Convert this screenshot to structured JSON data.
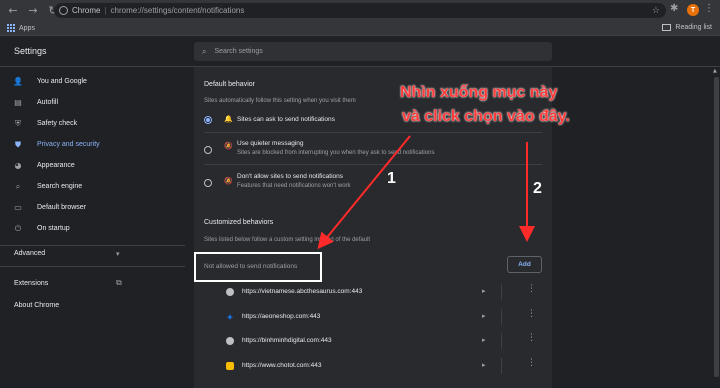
{
  "browser": {
    "site_label": "Chrome",
    "url": "chrome://settings/content/notifications",
    "avatar_letter": "T",
    "bookmarks_apps": "Apps",
    "reading_list": "Reading list"
  },
  "header": {
    "title": "Settings",
    "search_placeholder": "Search settings"
  },
  "sidebar": {
    "items": [
      {
        "label": "You and Google",
        "icon": "person-icon"
      },
      {
        "label": "Autofill",
        "icon": "clipboard-icon"
      },
      {
        "label": "Safety check",
        "icon": "shield-check-icon"
      },
      {
        "label": "Privacy and security",
        "icon": "shield-icon"
      },
      {
        "label": "Appearance",
        "icon": "palette-icon"
      },
      {
        "label": "Search engine",
        "icon": "search-icon"
      },
      {
        "label": "Default browser",
        "icon": "browser-icon"
      },
      {
        "label": "On startup",
        "icon": "power-icon"
      }
    ],
    "advanced": "Advanced",
    "extensions": "Extensions",
    "about": "About Chrome"
  },
  "content": {
    "default_behavior": {
      "title": "Default behavior",
      "subtitle": "Sites automatically follow this setting when you visit them",
      "options": [
        {
          "label": "Sites can ask to send notifications",
          "desc": "",
          "selected": true
        },
        {
          "label": "Use quieter messaging",
          "desc": "Sites are blocked from interrupting you when they ask to send notifications",
          "selected": false
        },
        {
          "label": "Don't allow sites to send notifications",
          "desc": "Features that need notifications won't work",
          "selected": false
        }
      ]
    },
    "customized": {
      "title": "Customized behaviors",
      "subtitle": "Sites listed below follow a custom setting instead of the default",
      "not_allowed": "Not allowed to send notifications",
      "add_label": "Add",
      "sites": [
        {
          "url": "https://vietnamese.abcthesaurus.com:443",
          "icon_color": "#bdc1c6",
          "icon_glyph": "◍"
        },
        {
          "url": "https://aeoneshop.com:443",
          "icon_color": "#1a73e8",
          "icon_glyph": "✦"
        },
        {
          "url": "https://binhminhdigital.com:443",
          "icon_color": "#bdc1c6",
          "icon_glyph": "◍"
        },
        {
          "url": "https://www.chotot.com:443",
          "icon_color": "#fbbc04",
          "icon_glyph": "●"
        }
      ]
    }
  },
  "annotation": {
    "line1": "Nhìn xuống mục này",
    "line2": "và click chọn vào đây.",
    "num1": "1",
    "num2": "2"
  }
}
